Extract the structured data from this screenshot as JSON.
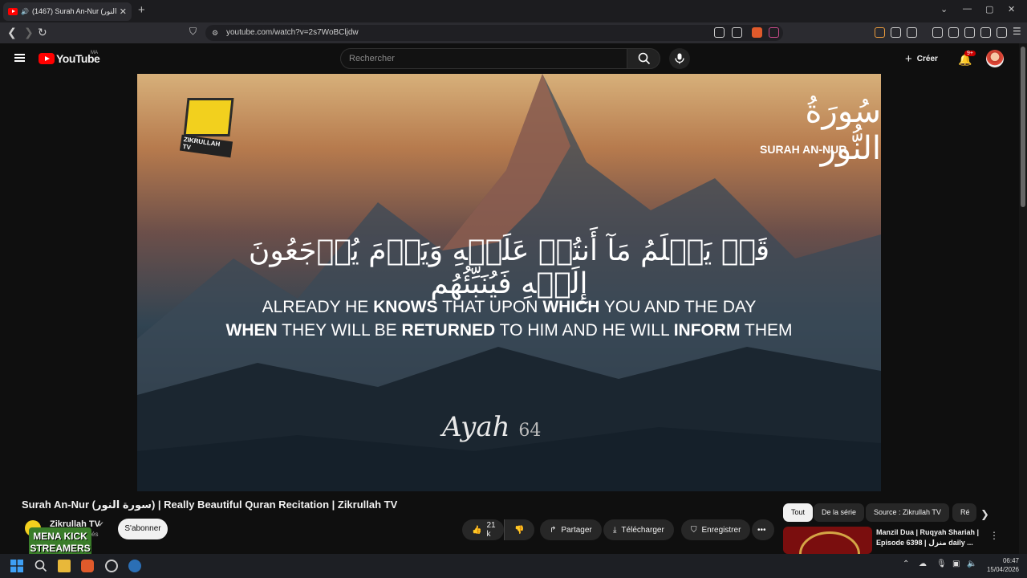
{
  "browser": {
    "tab_title": "(1467) Surah An-Nur (سورة النور",
    "tab_close": "✕",
    "new_tab": "+",
    "url": "youtube.com/watch?v=2s7WoBCljdw",
    "window_controls": [
      "⌄",
      "—",
      "▢",
      "✕"
    ]
  },
  "youtube": {
    "logo_text": "YouTube",
    "country_code": "MA",
    "search_placeholder": "Rechercher",
    "create_label": "Créer",
    "notification_badge": "9+"
  },
  "video": {
    "brand_label": "ZIKRULLAH TV",
    "surah_arabic": "سُورَةُ النُّور",
    "surah_english": "SURAH AN-NUR",
    "verse_arabic": "قَدۡ يَعۡلَمُ مَآ أَنتُمۡ عَلَيۡهِ وَيَوۡمَ يُرۡجَعُونَ إِلَيۡهِ فَيُنَبِّئُهُم",
    "verse_en_line1": [
      "ALREADY HE ",
      "KNOWS",
      " THAT UPON ",
      "WHICH",
      " YOU AND THE DAY"
    ],
    "verse_en_line2": [
      "WHEN",
      " THEY WILL BE ",
      "RETURNED",
      " TO HIM AND HE WILL ",
      "INFORM",
      " THEM"
    ],
    "ayah_label": "Ayah",
    "ayah_number": "64"
  },
  "watch": {
    "title": "Surah An-Nur (سورة النور) | Really Beautiful Quran Recitation | Zikrullah TV",
    "channel_name": "Zikrullah TV",
    "subscribers_partial": "és",
    "overlay_text": "MENA KICK STREAMERS",
    "subscribe_label": "S'abonner",
    "likes": "21 k",
    "share_label": "Partager",
    "download_label": "Télécharger",
    "save_label": "Enregistrer",
    "more_label": "•••"
  },
  "chips": [
    "Tout",
    "De la série",
    "Source : Zikrullah TV",
    "Ré"
  ],
  "recommendation": {
    "title": "Manzil Dua | Ruqyah Shariah | Episode 6398 | منزل daily ..."
  },
  "taskbar": {
    "time": "06:47",
    "date": "15/04/2026"
  },
  "colors": {
    "yt_red": "#ff0000",
    "bg": "#0f0f0f",
    "brand_yellow": "#f2d01e"
  }
}
